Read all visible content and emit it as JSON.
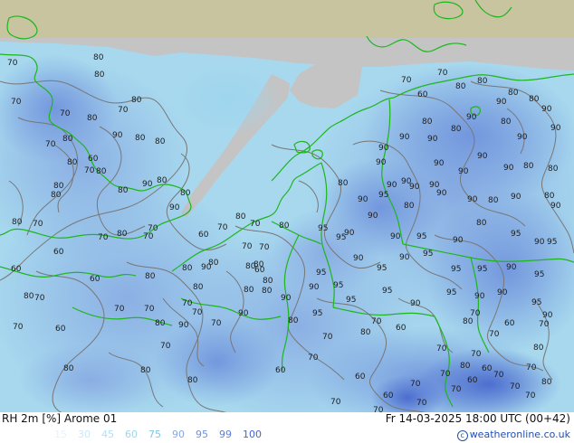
{
  "map": {
    "title": "RH 2m [%] Arome 01",
    "datetime": "Fr 14-03-2025 18:00 UTC (00+42)",
    "copyright": "weatheronline.co.uk",
    "legend": {
      "values": [
        "15",
        "30",
        "45",
        "60",
        "75",
        "90",
        "95",
        "99",
        "100"
      ],
      "colors": [
        "#e4f3fb",
        "#c9e9f6",
        "#b3e0f2",
        "#9dd5ee",
        "#7fc4e8",
        "#86a8e2",
        "#6f92dc",
        "#5d7fd6",
        "#4666cd"
      ]
    },
    "colors": {
      "land_outside": "#c8c4a0",
      "no_data": "#c4c4c4",
      "field_base": "#a7d8ee",
      "coast": "#1db61d",
      "contour": "#777777"
    },
    "contour_labels": [
      "70",
      "80",
      "70",
      "80",
      "70",
      "80",
      "80",
      "70",
      "60",
      "80",
      "70",
      "80",
      "90",
      "80",
      "80",
      "80",
      "70",
      "80",
      "80",
      "80",
      "90",
      "80",
      "80",
      "90",
      "70",
      "70",
      "80",
      "70",
      "60",
      "80",
      "70",
      "80",
      "90",
      "80",
      "60",
      "80",
      "70",
      "60",
      "60",
      "80",
      "70",
      "70",
      "70",
      "80",
      "70",
      "90",
      "80",
      "80",
      "60",
      "80",
      "70",
      "70",
      "60",
      "70",
      "80",
      "70",
      "80",
      "90",
      "80",
      "80",
      "90",
      "70",
      "70",
      "80",
      "70",
      "80",
      "80",
      "80",
      "60",
      "80",
      "70",
      "70",
      "80",
      "60",
      "60",
      "70",
      "70",
      "70",
      "60",
      "70",
      "70",
      "70",
      "80",
      "70",
      "70",
      "70",
      "60",
      "70",
      "80",
      "70",
      "70",
      "70",
      "80",
      "70",
      "60",
      "60",
      "70",
      "70",
      "80",
      "70",
      "60",
      "70",
      "80",
      "80",
      "90",
      "80",
      "80",
      "90",
      "80",
      "90",
      "80",
      "90",
      "80",
      "90",
      "90",
      "90",
      "90",
      "90",
      "90",
      "90",
      "90",
      "90",
      "80",
      "80",
      "90",
      "90",
      "90",
      "90",
      "90",
      "90",
      "80",
      "90",
      "80",
      "90",
      "80",
      "80",
      "90",
      "90",
      "90",
      "95",
      "90",
      "80",
      "95",
      "90",
      "95",
      "95",
      "90",
      "95",
      "95",
      "90",
      "95",
      "90",
      "95",
      "95",
      "95",
      "90",
      "95",
      "95",
      "90",
      "95",
      "90",
      "90",
      "95",
      "90",
      "95",
      "95",
      "95",
      "90",
      "95",
      "95",
      "90",
      "80",
      "95",
      "90"
    ]
  }
}
